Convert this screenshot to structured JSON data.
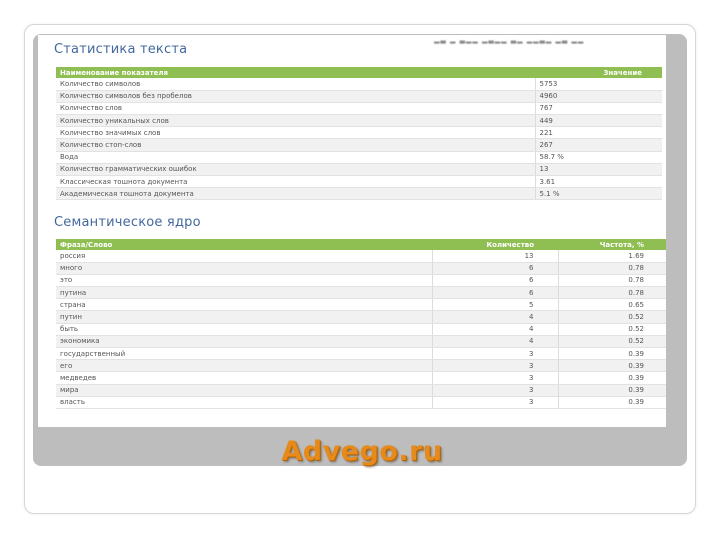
{
  "stats": {
    "title": "Статистика текста",
    "headers": [
      "Наименование показателя",
      "Значение"
    ],
    "rows": [
      [
        "Количество символов",
        "5753"
      ],
      [
        "Количество символов без пробелов",
        "4960"
      ],
      [
        "Количество слов",
        "767"
      ],
      [
        "Количество уникальных слов",
        "449"
      ],
      [
        "Количество значимых слов",
        "221"
      ],
      [
        "Количество стоп-слов",
        "267"
      ],
      [
        "Вода",
        "58.7 %"
      ],
      [
        "Количество грамматических ошибок",
        "13"
      ],
      [
        "Классическая тошнота документа",
        "3.61"
      ],
      [
        "Академическая тошнота документа",
        "5.1 %"
      ]
    ]
  },
  "semantic": {
    "title": "Семантическое ядро",
    "headers": [
      "Фраза/Слово",
      "Количество",
      "Частота, %"
    ],
    "rows": [
      [
        "россия",
        "13",
        "1.69"
      ],
      [
        "много",
        "6",
        "0.78"
      ],
      [
        "это",
        "6",
        "0.78"
      ],
      [
        "путина",
        "6",
        "0.78"
      ],
      [
        "страна",
        "5",
        "0.65"
      ],
      [
        "путин",
        "4",
        "0.52"
      ],
      [
        "быть",
        "4",
        "0.52"
      ],
      [
        "экономика",
        "4",
        "0.52"
      ],
      [
        "государственный",
        "3",
        "0.39"
      ],
      [
        "его",
        "3",
        "0.39"
      ],
      [
        "медведев",
        "3",
        "0.39"
      ],
      [
        "мира",
        "3",
        "0.39"
      ],
      [
        "власть",
        "3",
        "0.39"
      ]
    ]
  },
  "brand": {
    "text": "Advego.ru",
    "color": "#e58a1b"
  },
  "colors": {
    "header_green": "#8fbf52",
    "title_blue": "#44689e",
    "panel_gray": "#bdbdbd"
  }
}
